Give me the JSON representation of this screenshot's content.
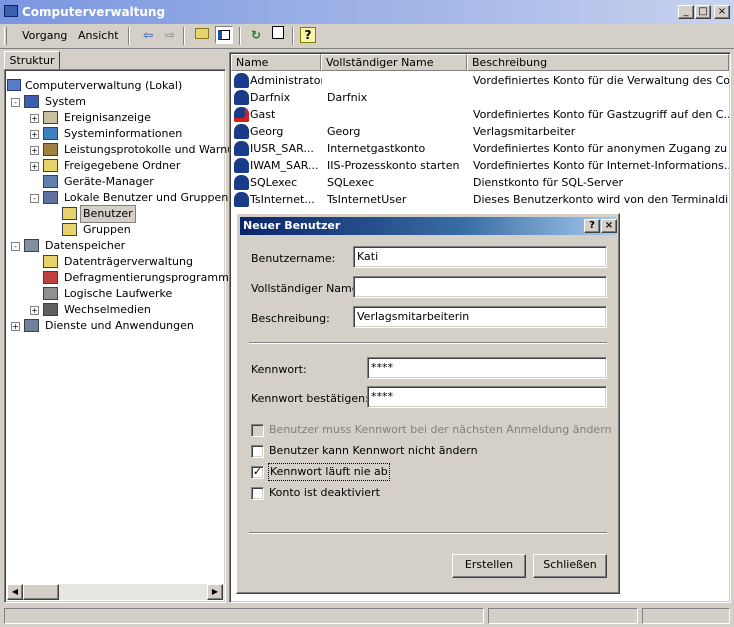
{
  "window": {
    "title": "Computerverwaltung"
  },
  "menu": {
    "items": [
      "Vorgang",
      "Ansicht"
    ]
  },
  "tab": {
    "label": "Struktur"
  },
  "tree": {
    "root": "Computerverwaltung (Lokal)",
    "items": [
      "System",
      "Ereignisanzeige",
      "Systeminformationen",
      "Leistungsprotokolle und Warnung",
      "Freigegebene Ordner",
      "Geräte-Manager",
      "Lokale Benutzer und Gruppen",
      "Benutzer",
      "Gruppen",
      "Datenspeicher",
      "Datenträgerverwaltung",
      "Defragmentierungsprogramm",
      "Logische Laufwerke",
      "Wechselmedien",
      "Dienste und Anwendungen"
    ]
  },
  "list": {
    "headers": [
      "Name",
      "Vollständiger Name",
      "Beschreibung"
    ],
    "rows": [
      [
        "Administrator",
        "",
        "Vordefiniertes Konto für die Verwaltung des Co..."
      ],
      [
        "Darfnix",
        "Darfnix",
        ""
      ],
      [
        "Gast",
        "",
        "Vordefiniertes Konto für Gastzugriff auf den C..."
      ],
      [
        "Georg",
        "Georg",
        "Verlagsmitarbeiter"
      ],
      [
        "IUSR_SAR...",
        "Internetgastkonto",
        "Vordefiniertes Konto für anonymen Zugang zu ..."
      ],
      [
        "IWAM_SAR...",
        "IIS-Prozesskonto starten",
        "Vordefiniertes Konto für Internet-Informations..."
      ],
      [
        "SQLexec",
        "SQLexec",
        "Dienstkonto für SQL-Server"
      ],
      [
        "TsInternet...",
        "TsInternetUser",
        "Dieses Benutzerkonto wird von den Terminaldi..."
      ]
    ]
  },
  "dialog": {
    "title": "Neuer Benutzer",
    "help": "?",
    "close": "×",
    "username_label": "Benutzername:",
    "username_value": "Kati",
    "fullname_label": "Vollständiger Name:",
    "fullname_value": "",
    "description_label": "Beschreibung:",
    "description_value": "Verlagsmitarbeiterin",
    "password_label": "Kennwort:",
    "password_value": "****",
    "confirm_label": "Kennwort bestätigen:",
    "confirm_value": "****",
    "chk_must_change": "Benutzer muss Kennwort bei der nächsten Anmeldung ändern",
    "chk_cannot_change": "Benutzer kann Kennwort nicht ändern",
    "chk_never_expires": "Kennwort läuft nie ab",
    "chk_disabled": "Konto ist deaktiviert",
    "create_button": "Erstellen",
    "close_button": "Schließen"
  }
}
